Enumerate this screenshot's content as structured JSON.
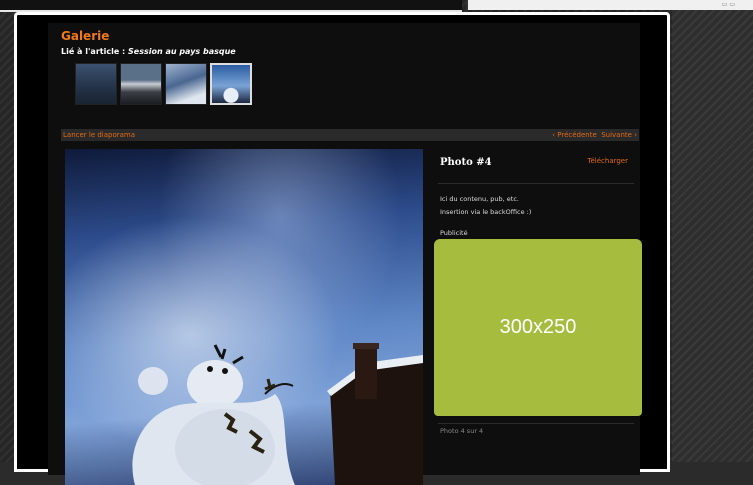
{
  "gallery": {
    "title": "Galerie",
    "related_prefix": "Lié à l'article : ",
    "related_article": "Session au pays basque",
    "thumbnails": [
      "thumbnail-1",
      "thumbnail-2",
      "thumbnail-3",
      "thumbnail-4"
    ],
    "selected_index": 4
  },
  "toolbar": {
    "slideshow_label": "Lancer le diaporama",
    "previous_label": "‹ Précédente",
    "next_label": "Suivante ›"
  },
  "sidebar": {
    "photo_title": "Photo #4",
    "download_label": "Télécharger",
    "description_line1": "Ici du contenu, pub, etc.",
    "description_line2": "Insertion via le backOffice :)",
    "ad_label": "Publicité",
    "ad_size": "300x250",
    "counter": "Photo 4 sur 4"
  },
  "colors": {
    "accent": "#f07a1a",
    "ad_background": "#a6bc3e"
  }
}
